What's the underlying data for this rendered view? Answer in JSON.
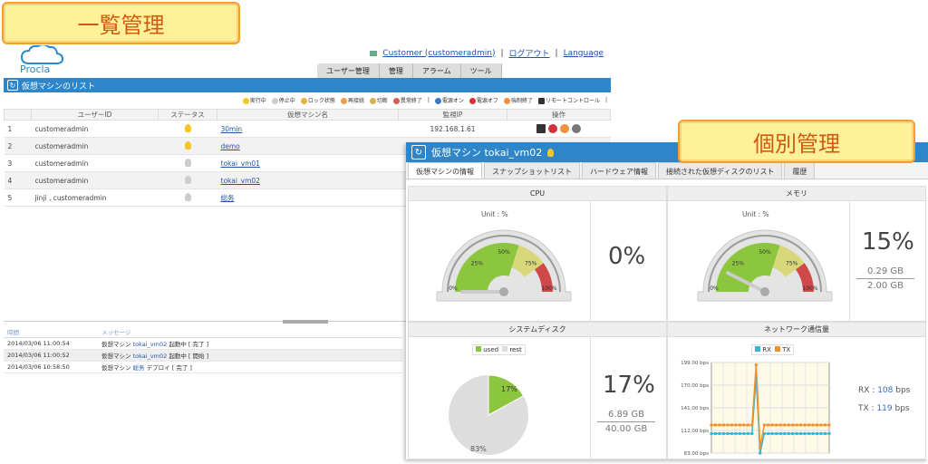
{
  "callouts": {
    "list": "一覧管理",
    "detail": "個別管理"
  },
  "list_window": {
    "logo": "Procla",
    "top_links": {
      "user": "Customer (customeradmin)",
      "logout": "ログアウト",
      "language": "Language"
    },
    "menu": [
      "ユーザー管理",
      "管理",
      "アラーム",
      "ツール"
    ],
    "panel_title": "仮想マシンのリスト",
    "legend": [
      "実行中",
      "停止中",
      "ロック状態",
      "再接続",
      "切断",
      "異常終了",
      "電源オン",
      "電源オフ",
      "強制終了",
      "リモートコントロール"
    ],
    "columns": [
      "ユーザーID",
      "ステータス",
      "仮想マシン名",
      "監視IP",
      "操作"
    ],
    "rows": [
      {
        "no": "1",
        "user": "customeradmin",
        "status": "on",
        "name": "30min",
        "ip": "192.168.1.61"
      },
      {
        "no": "2",
        "user": "customeradmin",
        "status": "on",
        "name": "demo",
        "ip": ""
      },
      {
        "no": "3",
        "user": "customeradmin",
        "status": "off",
        "name": "tokai_vm01",
        "ip": ""
      },
      {
        "no": "4",
        "user": "customeradmin",
        "status": "off",
        "name": "tokai_vm02",
        "ip": ""
      },
      {
        "no": "5",
        "user": "jinji , customeradmin",
        "status": "off",
        "name": "総务",
        "ip": ""
      }
    ],
    "log_columns": [
      "時間",
      "メッセージ"
    ],
    "log_rows": [
      {
        "time": "2014/03/06 11:00:54",
        "pre": "仮想マシン",
        "vm": "tokai_vm02",
        "post": "起動中 [ 完了 ]"
      },
      {
        "time": "2014/03/06 11:00:52",
        "pre": "仮想マシン",
        "vm": "tokai_vm02",
        "post": "起動中 [ 開始 ]"
      },
      {
        "time": "2014/03/06 10:58:50",
        "pre": "仮想マシン",
        "vm": "総务",
        "post": "デプロイ [ 完了 ]"
      }
    ]
  },
  "detail": {
    "title": "仮想マシン tokai_vm02",
    "tabs": [
      "仮想マシンの情報",
      "スナップショットリスト",
      "ハードウェア情報",
      "接続された仮想ディスクのリスト",
      "履歴"
    ],
    "cpu": {
      "header": "CPU",
      "unit": "Unit : %",
      "value": 0,
      "display": "0%"
    },
    "memory": {
      "header": "メモリ",
      "unit": "Unit : %",
      "value": 15,
      "display": "15%",
      "used": "0.29 GB",
      "total": "2.00 GB"
    },
    "disk": {
      "header": "システムディスク",
      "legend": [
        "used",
        "rest"
      ],
      "used_pct": 17,
      "rest_pct": 83,
      "display": "17%",
      "used": "6.89 GB",
      "total": "40.00 GB",
      "slice_labels": [
        "17%",
        "83%"
      ]
    },
    "network": {
      "header": "ネットワーク通信量",
      "legend": [
        "RX",
        "TX"
      ],
      "rx_label": "RX :",
      "rx": "108",
      "tx_label": "TX :",
      "tx": "119",
      "unit": "bps",
      "y_ticks": [
        "199.00 bps",
        "170.00 bps",
        "141.00 bps",
        "112.00 bps",
        "83.00 bps"
      ]
    },
    "gauge_ticks": [
      "0%",
      "25%",
      "50%",
      "75%",
      "100%"
    ]
  },
  "chart_data": {
    "type": "line",
    "title": "ネットワーク通信量",
    "ylim": [
      83,
      199
    ],
    "x": [
      1,
      2,
      3,
      4,
      5,
      6,
      7,
      8,
      9,
      10,
      11,
      12,
      13,
      14,
      15,
      16,
      17,
      18,
      19,
      20,
      21,
      22,
      23,
      24,
      25,
      26,
      27,
      28,
      29,
      30
    ],
    "series": [
      {
        "name": "RX",
        "color": "#35b6d8",
        "values": [
          108,
          108,
          108,
          108,
          108,
          108,
          108,
          108,
          108,
          108,
          108,
          180,
          83,
          108,
          108,
          108,
          108,
          108,
          108,
          108,
          108,
          108,
          108,
          108,
          108,
          108,
          108,
          108,
          108,
          108
        ]
      },
      {
        "name": "TX",
        "color": "#f0902a",
        "values": [
          119,
          119,
          119,
          119,
          119,
          119,
          119,
          119,
          119,
          119,
          119,
          196,
          90,
          119,
          119,
          119,
          119,
          119,
          119,
          119,
          119,
          119,
          119,
          119,
          119,
          119,
          119,
          119,
          119,
          119
        ]
      }
    ],
    "legend": "top"
  },
  "colors": {
    "accent": "#2e86c8",
    "bulb_on": "#f7c623",
    "gauge_green": "#8cc63f",
    "gauge_yellow": "#d8d87a",
    "gauge_red": "#d04848"
  }
}
